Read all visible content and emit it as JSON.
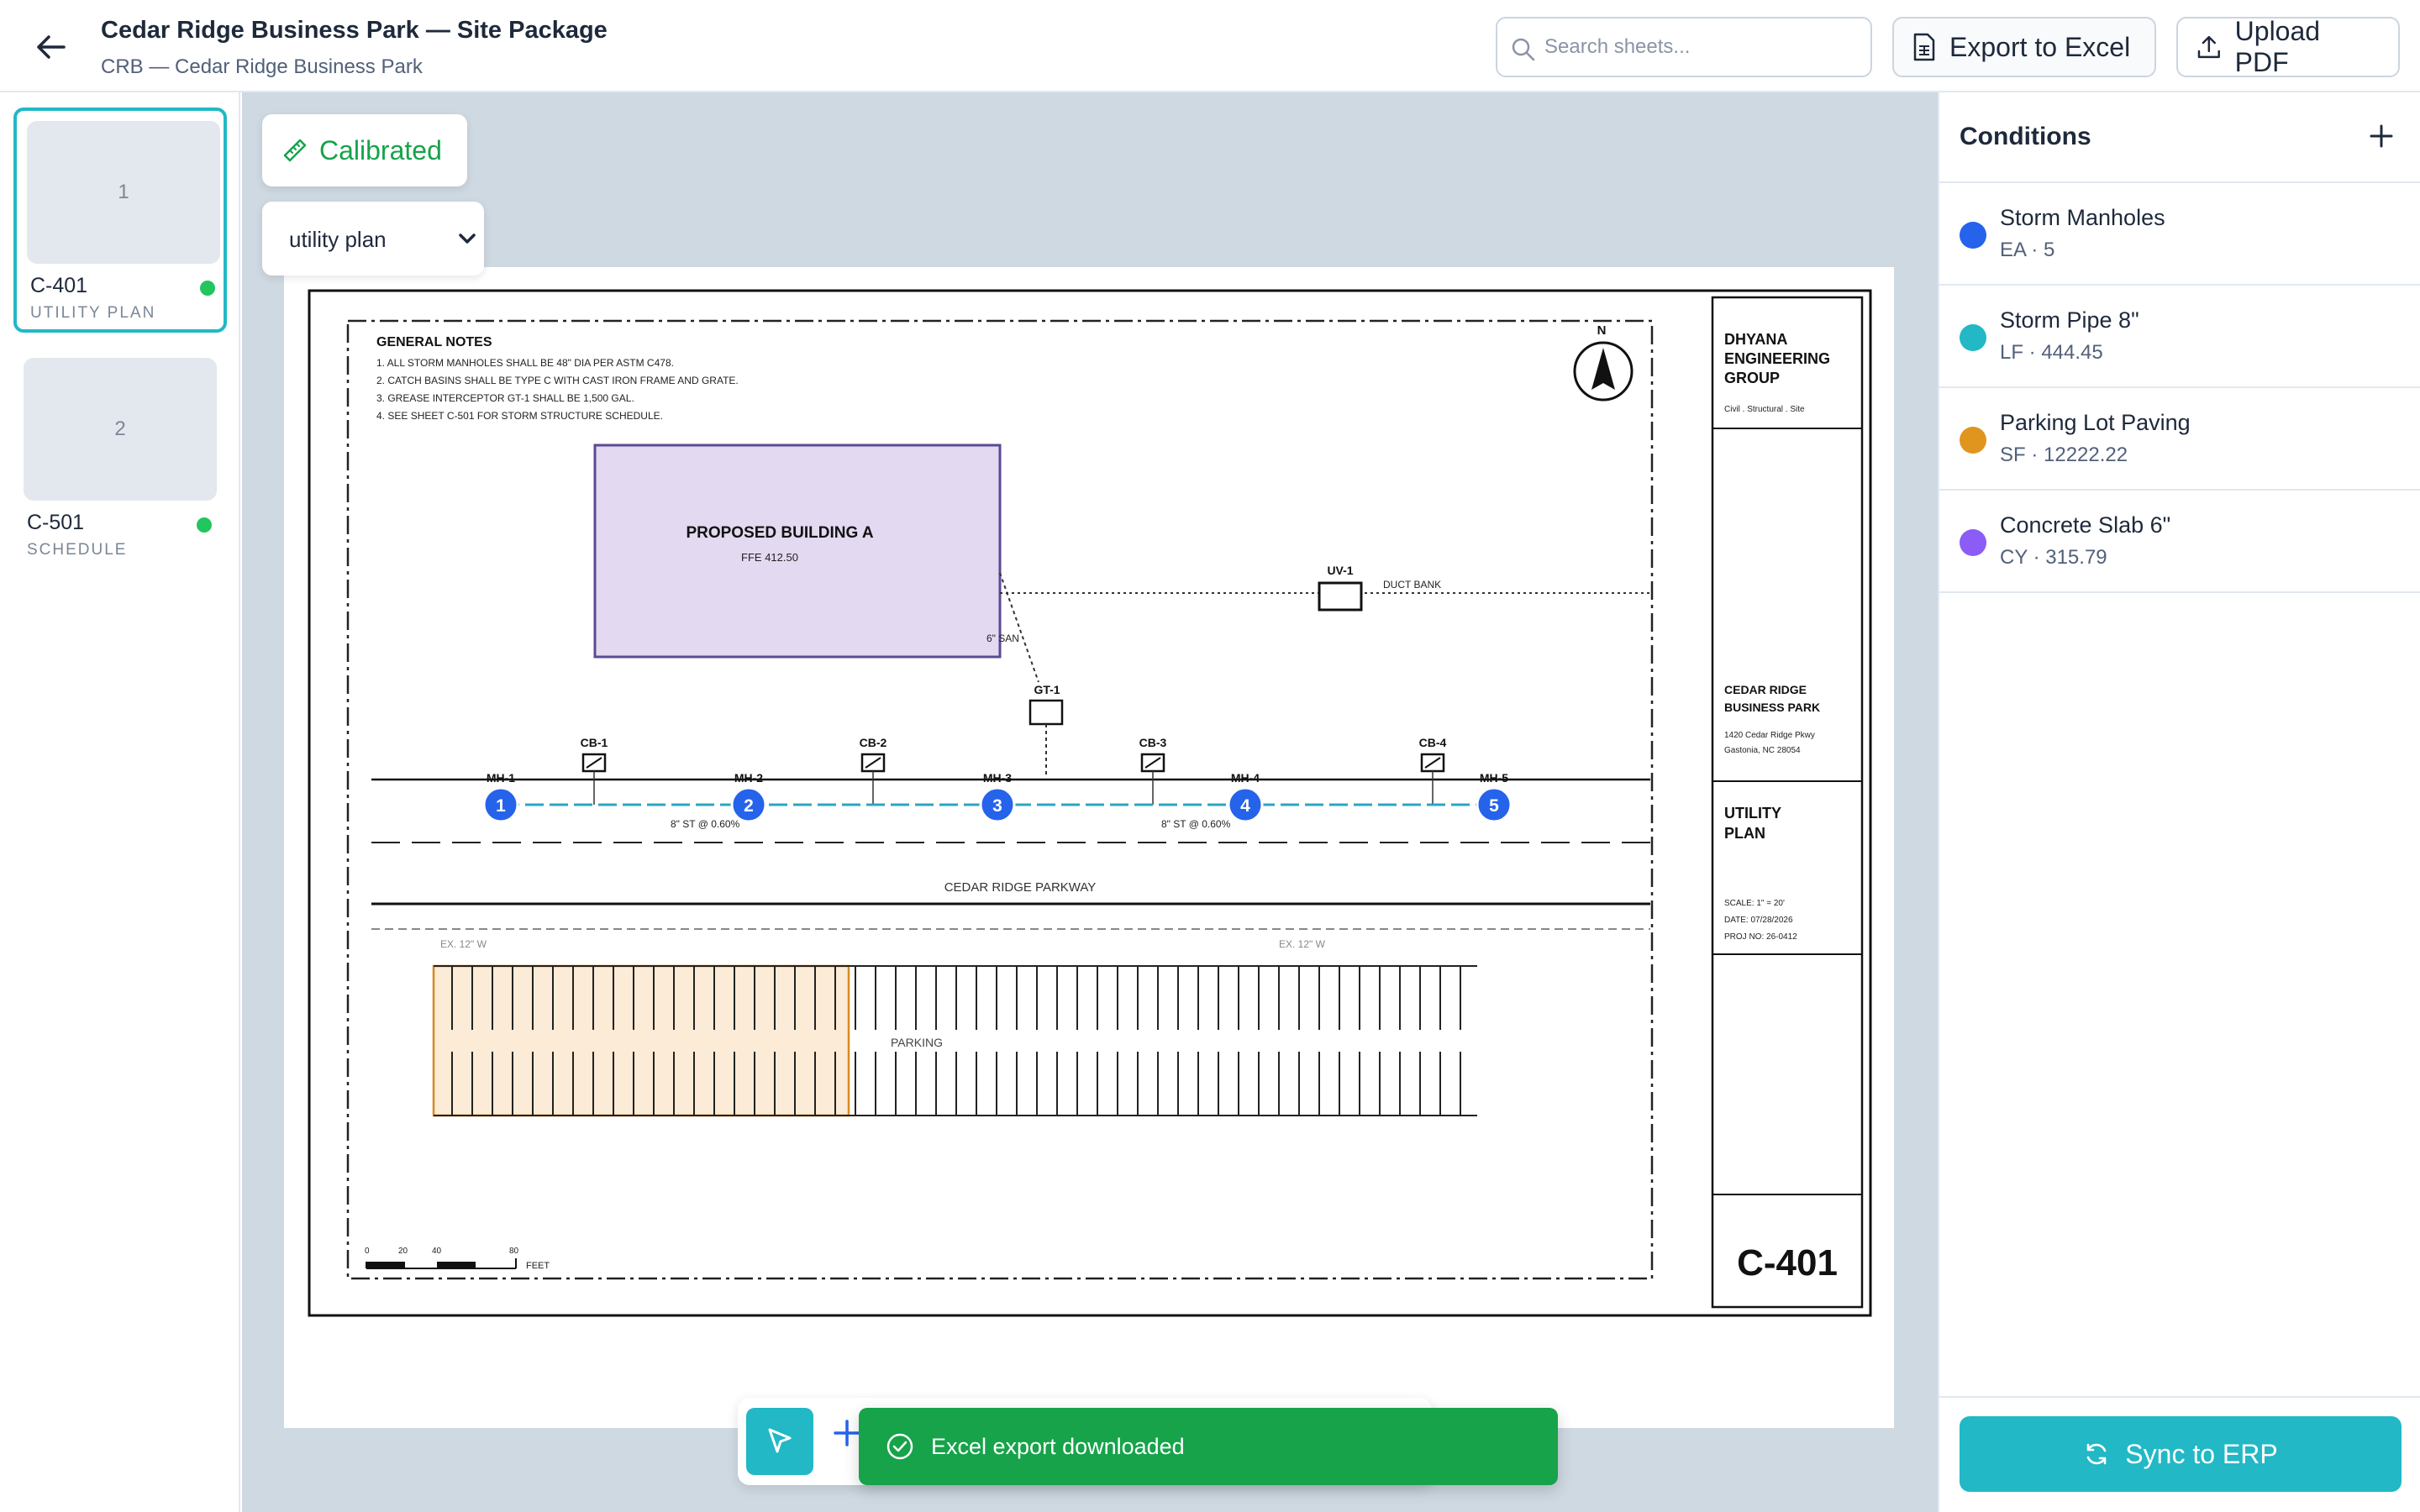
{
  "header": {
    "title": "Cedar Ridge Business Park — Site Package",
    "subtitle": "CRB — Cedar Ridge Business Park",
    "search_placeholder": "Search sheets...",
    "export_label": "Export to Excel",
    "upload_label": "Upload PDF"
  },
  "sheets": [
    {
      "thumb": "1",
      "number": "C-401",
      "name": "UTILITY PLAN",
      "status_color": "#22c55e",
      "active": true
    },
    {
      "thumb": "2",
      "number": "C-501",
      "name": "SCHEDULE",
      "status_color": "#22c55e",
      "active": false
    }
  ],
  "canvas": {
    "calibration_label": "Calibrated",
    "sheet_type_value": "utility plan"
  },
  "drawing": {
    "notes_title": "GENERAL NOTES",
    "notes": [
      "1. ALL STORM MANHOLES SHALL BE 48\" DIA PER ASTM C478.",
      "2. CATCH BASINS SHALL BE TYPE C WITH CAST IRON FRAME AND GRATE.",
      "3. GREASE INTERCEPTOR GT-1 SHALL BE 1,500 GAL.",
      "4. SEE SHEET C-501 FOR STORM STRUCTURE SCHEDULE."
    ],
    "north_label": "N",
    "building_name": "PROPOSED BUILDING A",
    "building_ffe": "FFE 412.50",
    "uv_label": "UV-1",
    "duct_label": "DUCT BANK",
    "san_label": "6\" SAN",
    "gt_label": "GT-1",
    "catch_basins": [
      "CB-1",
      "CB-2",
      "CB-3",
      "CB-4"
    ],
    "manholes": [
      "MH-1",
      "MH-2",
      "MH-3",
      "MH-4",
      "MH-5"
    ],
    "manhole_markers": [
      "1",
      "2",
      "3",
      "4",
      "5"
    ],
    "pipe_label_1": "8\" ST @ 0.60%",
    "pipe_label_2": "8\" ST @ 0.60%",
    "road_label": "CEDAR RIDGE PARKWAY",
    "water_label_1": "EX. 12\" W",
    "water_label_2": "EX. 12\" W",
    "parking_label": "PARKING",
    "scale_ticks": [
      "0",
      "20",
      "40",
      "80"
    ],
    "scale_unit": "FEET",
    "firm_name_lines": [
      "DHYANA",
      "ENGINEERING",
      "GROUP"
    ],
    "firm_disciplines": "Civil . Structural . Site",
    "project_lines": [
      "CEDAR RIDGE",
      "BUSINESS PARK"
    ],
    "address_lines": [
      "1420 Cedar Ridge Pkwy",
      "Gastonia, NC 28054"
    ],
    "sheet_title_lines": [
      "UTILITY",
      "PLAN"
    ],
    "scale_text": "SCALE: 1\" = 20'",
    "date_text": "DATE: 07/28/2026",
    "proj_text": "PROJ NO: 26-0412",
    "sheet_number": "C-401"
  },
  "toast": {
    "message": "Excel export downloaded",
    "color": "#16a34a"
  },
  "conditions_panel": {
    "title": "Conditions",
    "items": [
      {
        "name": "Storm Manholes",
        "meta": "EA · 5",
        "color": "#2563eb"
      },
      {
        "name": "Storm Pipe 8\"",
        "meta": "LF · 444.45",
        "color": "#22b8c5"
      },
      {
        "name": "Parking Lot Paving",
        "meta": "SF · 12222.22",
        "color": "#e0951f"
      },
      {
        "name": "Concrete Slab 6\"",
        "meta": "CY · 315.79",
        "color": "#8b5cf6"
      }
    ],
    "sync_label": "Sync to ERP"
  },
  "colors": {
    "accent": "#22b8c5",
    "success": "#16a34a",
    "manhole_marker": "#2563eb",
    "building_fill": "#e3d9f0",
    "paving_fill": "#fcebd6"
  },
  "icons": [
    "back-arrow-icon",
    "search-icon",
    "file-spreadsheet-icon",
    "upload-icon",
    "ruler-icon",
    "chevron-down-icon",
    "cursor-icon",
    "plus-icon",
    "check-circle-icon",
    "sync-icon"
  ]
}
